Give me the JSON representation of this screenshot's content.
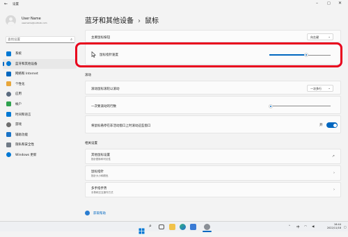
{
  "window": {
    "title": "设置",
    "back_icon": "back-arrow-icon"
  },
  "profile": {
    "name": "User Name",
    "email": "username@outlook.com"
  },
  "search": {
    "placeholder": "查找设置"
  },
  "nav": [
    {
      "label": "系统",
      "icon": "system-icon",
      "color": "#0078d4"
    },
    {
      "label": "蓝牙和其他设备",
      "icon": "bluetooth-icon",
      "color": "#0078d4",
      "active": true
    },
    {
      "label": "网络和 Internet",
      "icon": "network-icon",
      "color": "#0067c0"
    },
    {
      "label": "个性化",
      "icon": "personalization-icon",
      "color": "#e8a63a"
    },
    {
      "label": "应用",
      "icon": "apps-icon",
      "color": "#5b6b7f"
    },
    {
      "label": "帐户",
      "icon": "accounts-icon",
      "color": "#2fa24e"
    },
    {
      "label": "时间和语言",
      "icon": "time-language-icon",
      "color": "#0078d4"
    },
    {
      "label": "游戏",
      "icon": "gaming-icon",
      "color": "#6e6e6e"
    },
    {
      "label": "辅助功能",
      "icon": "accessibility-icon",
      "color": "#1a73c7"
    },
    {
      "label": "隐私和安全性",
      "icon": "privacy-icon",
      "color": "#707a86"
    },
    {
      "label": "Windows 更新",
      "icon": "windows-update-icon",
      "color": "#0078d4"
    }
  ],
  "breadcrumb": {
    "parent": "蓝牙和其他设备",
    "separator": "›",
    "current": "鼠标"
  },
  "primary_button": {
    "label": "主要鼠标按钮",
    "value": "向左键"
  },
  "pointer_speed": {
    "label": "鼠标指针速度",
    "value_fraction": 0.6
  },
  "scroll_section": {
    "title": "滚动"
  },
  "wheel_roll": {
    "label": "滚动鼠标滚轮以滚动",
    "value": "一次多行"
  },
  "lines_per_scroll": {
    "label": "一次要滚动的行数",
    "value_fraction": 0.02
  },
  "inactive_scroll": {
    "label": "将鼠标悬停在非活动窗口上时滚动这些窗口",
    "toggle_label": "开",
    "on": true
  },
  "related_section": {
    "title": "相关设置"
  },
  "related": [
    {
      "title": "其他鼠标设置",
      "subtitle": "指针图标和可见性"
    },
    {
      "title": "鼠标指针",
      "subtitle": "指针大小和颜色"
    },
    {
      "title": "多手指手势",
      "subtitle": "手势和交互操作方式"
    }
  ],
  "help": {
    "label": "获取帮助"
  },
  "taskbar": {
    "apps": [
      "windows-start-icon",
      "search-icon",
      "task-view-icon",
      "file-explorer-icon",
      "edge-icon",
      "store-icon",
      "settings-icon"
    ],
    "time": "16:44",
    "date": "2022/11/18"
  }
}
